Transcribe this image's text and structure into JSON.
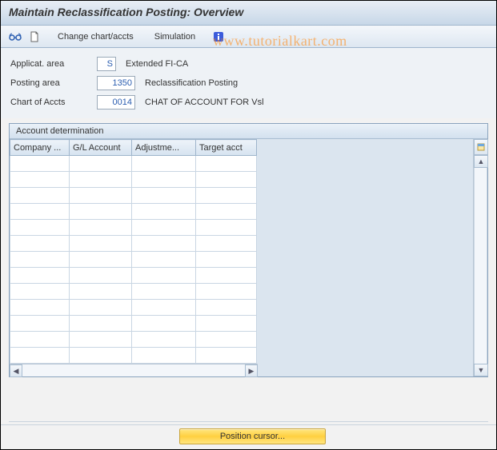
{
  "title": "Maintain Reclassification Posting: Overview",
  "toolbar": {
    "change_chart_accts": "Change chart/accts",
    "simulation": "Simulation"
  },
  "watermark": "www.tutorialkart.com",
  "form": {
    "applicat_area": {
      "label": "Applicat. area",
      "value": "S",
      "desc": "Extended FI-CA"
    },
    "posting_area": {
      "label": "Posting area",
      "value": "1350",
      "desc": "Reclassification Posting"
    },
    "chart_of_accts": {
      "label": "Chart of Accts",
      "value": "0014",
      "desc": "CHAT OF ACCOUNT FOR Vsl"
    }
  },
  "table": {
    "panel_title": "Account determination",
    "columns": [
      "Company ...",
      "G/L Account",
      "Adjustme...",
      "Target acct"
    ],
    "rows": [
      [
        "",
        "",
        "",
        ""
      ],
      [
        "",
        "",
        "",
        ""
      ],
      [
        "",
        "",
        "",
        ""
      ],
      [
        "",
        "",
        "",
        ""
      ],
      [
        "",
        "",
        "",
        ""
      ],
      [
        "",
        "",
        "",
        ""
      ],
      [
        "",
        "",
        "",
        ""
      ],
      [
        "",
        "",
        "",
        ""
      ],
      [
        "",
        "",
        "",
        ""
      ],
      [
        "",
        "",
        "",
        ""
      ],
      [
        "",
        "",
        "",
        ""
      ],
      [
        "",
        "",
        "",
        ""
      ],
      [
        "",
        "",
        "",
        ""
      ]
    ]
  },
  "footer": {
    "position_cursor": "Position cursor..."
  }
}
